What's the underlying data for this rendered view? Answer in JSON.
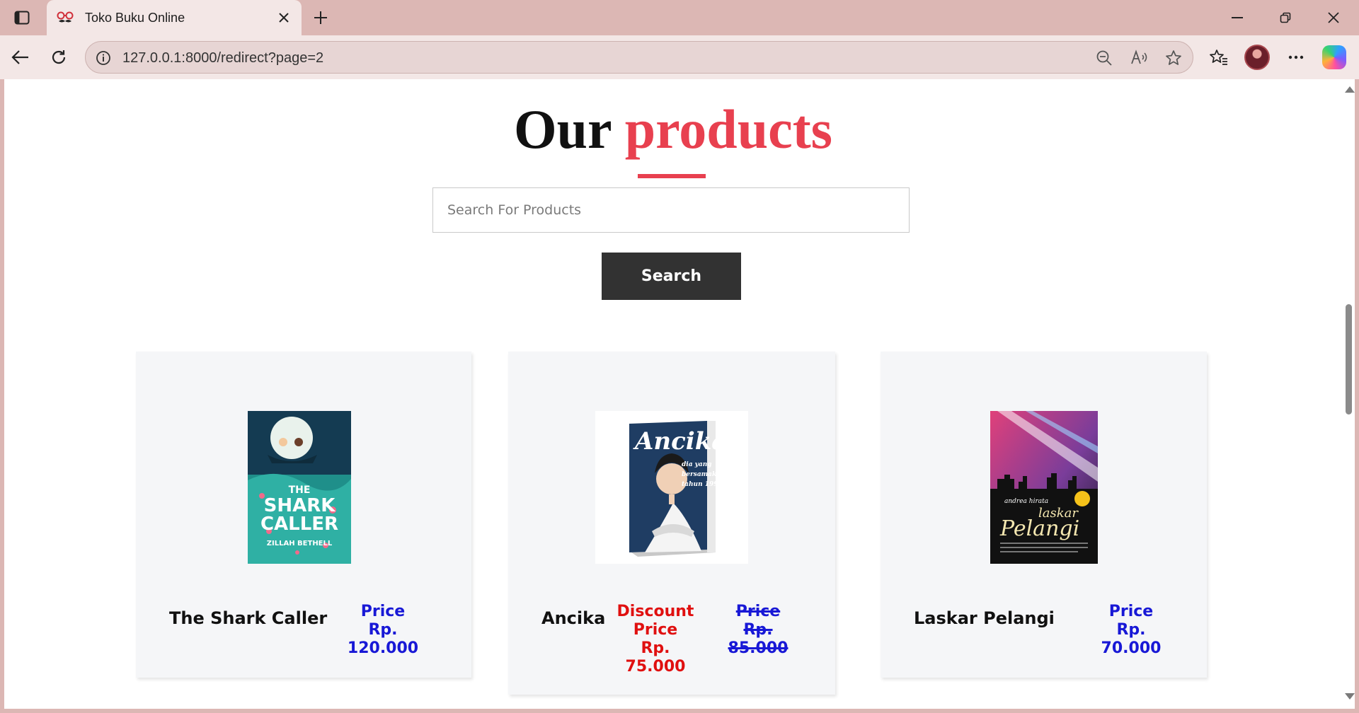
{
  "browser": {
    "tab_title": "Toko Buku Online",
    "url": "127.0.0.1:8000/redirect?page=2",
    "icons": [
      "sidebar-toggle-icon",
      "mustache-favicon-icon",
      "close-icon",
      "plus-icon",
      "minimize-icon",
      "restore-icon",
      "close-window-icon",
      "back-arrow-icon",
      "refresh-icon",
      "info-icon",
      "zoom-out-icon",
      "read-aloud-icon",
      "star-icon",
      "favorites-icon",
      "more-icon",
      "copilot-icon"
    ]
  },
  "page": {
    "heading": {
      "dark": "Our",
      "accent": "products"
    },
    "search": {
      "placeholder": "Search For Products",
      "value": "",
      "button_label": "Search"
    },
    "colors": {
      "accent": "#e8404f",
      "price_blue": "#1818d6",
      "discount_red": "#e01010",
      "button_dark": "#323232",
      "card_bg": "#f5f6f8"
    },
    "products": [
      {
        "name": "The Shark Caller",
        "price_label": "Price",
        "price": "Rp. 120.000"
      },
      {
        "name": "Ancika",
        "discount_label": "Discount",
        "discount_price_label": "Price",
        "discount_price": "Rp. 75.000",
        "original_price_label": "Price",
        "original_currency": "Rp.",
        "original_price": "85.000"
      },
      {
        "name": "Laskar Pelangi",
        "price_label": "Price",
        "price": "Rp. 70.000"
      }
    ]
  }
}
